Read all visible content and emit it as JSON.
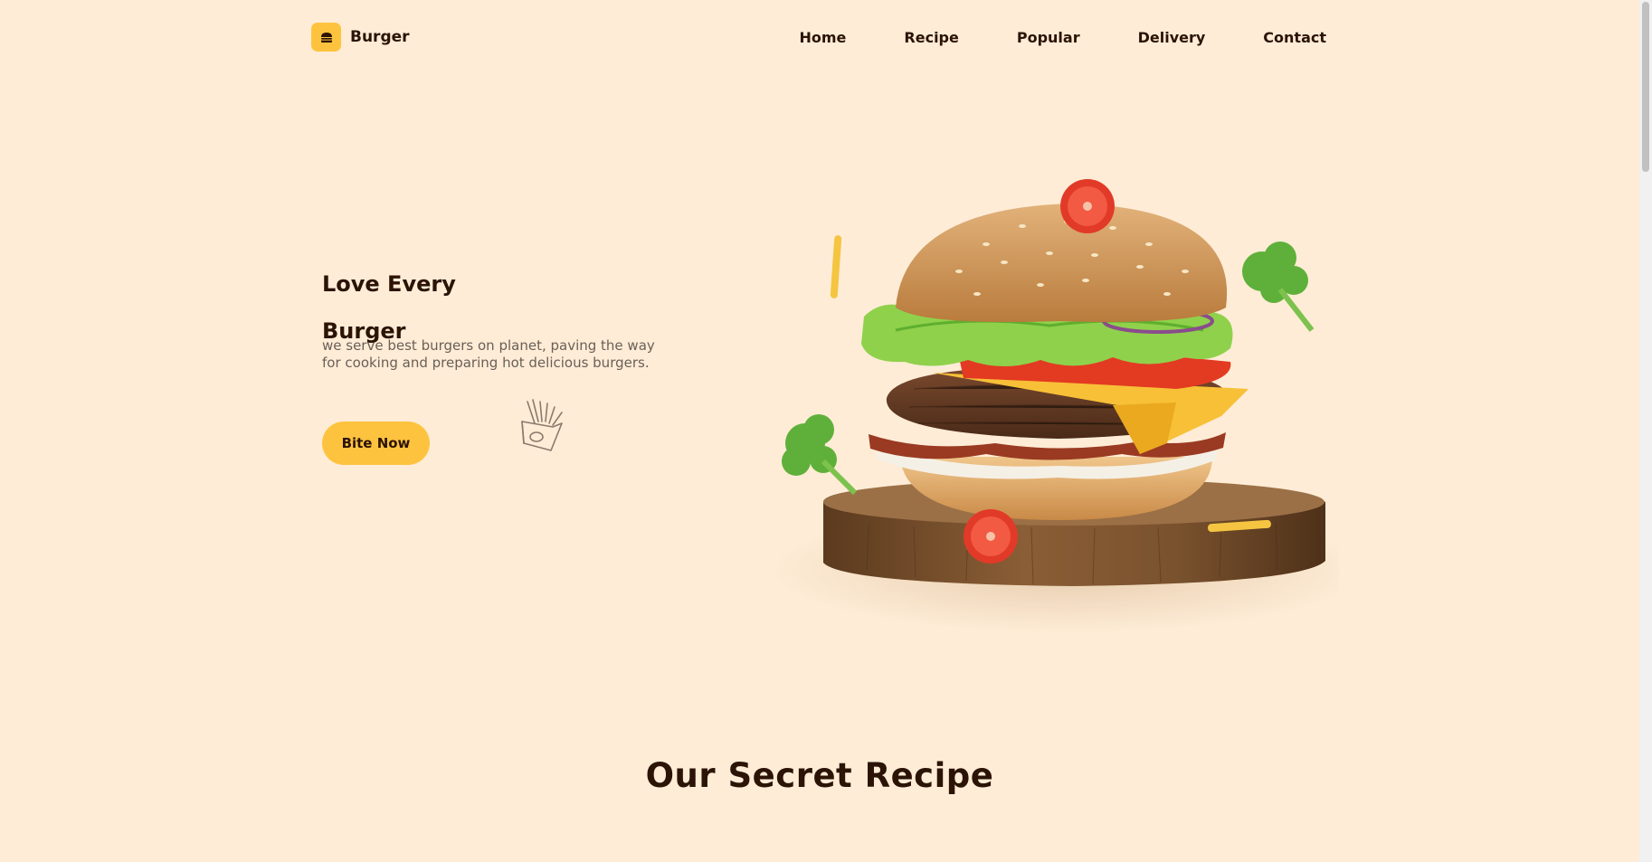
{
  "brand": {
    "name": "Burger",
    "icon": "burger-icon",
    "accent": "#fec33e"
  },
  "nav": {
    "items": [
      {
        "label": "Home"
      },
      {
        "label": "Recipe"
      },
      {
        "label": "Popular"
      },
      {
        "label": "Delivery"
      },
      {
        "label": "Contact"
      }
    ]
  },
  "hero": {
    "title_line1": "Love Every",
    "title_line2": "Burger",
    "description": "we serve best burgers on planet, paving the way for cooking and preparing hot delicious burgers.",
    "cta_label": "Bite Now",
    "doodle_icon": "fries-icon",
    "image": "burger-on-wooden-board-image"
  },
  "section": {
    "title": "Our Secret Recipe"
  },
  "colors": {
    "background": "#feecd6",
    "text": "#2b1306",
    "muted": "#6a5f57"
  }
}
